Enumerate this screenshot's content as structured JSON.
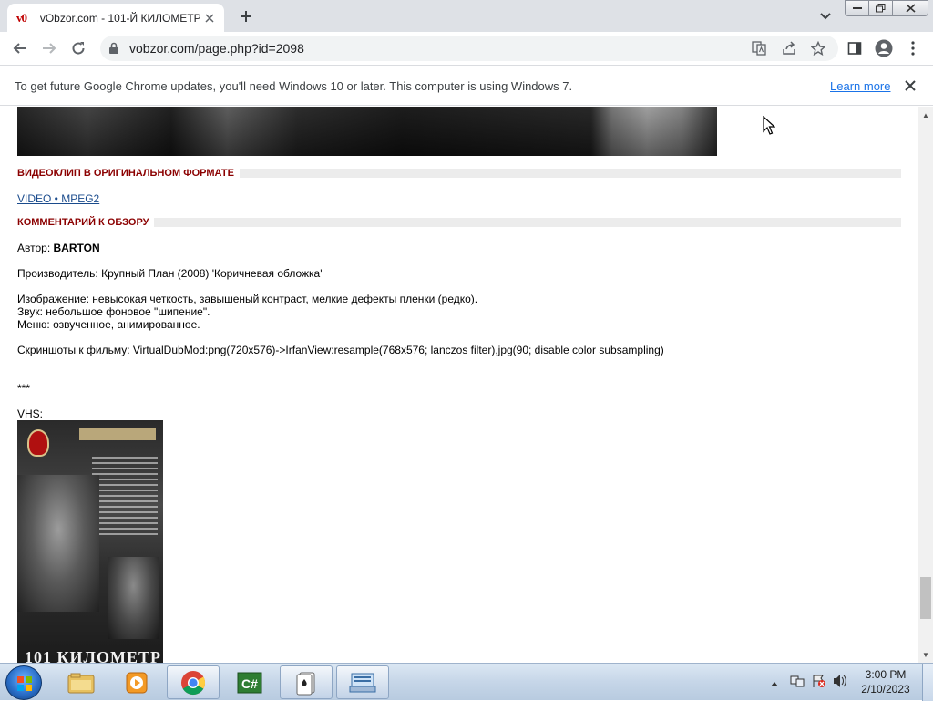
{
  "browser": {
    "tab": {
      "favicon_text": "v0",
      "title": "vObzor.com - 101-Й КИЛОМЕТР"
    },
    "address": {
      "url": "vobzor.com/page.php?id=2098"
    },
    "window_controls": [
      "minimize",
      "maximize",
      "close"
    ]
  },
  "infobar": {
    "message": "To get future Google Chrome updates, you'll need Windows 10 or later. This computer is using Windows 7.",
    "link": "Learn more"
  },
  "page": {
    "sections": {
      "video_clip_title": "ВИДЕОКЛИП В ОРИГИНАЛЬНОМ ФОРМАТЕ",
      "video_link": "VIDEO • MPEG2",
      "comment_title": "КОММЕНТАРИЙ К ОБЗОРУ"
    },
    "author_label": "Автор:",
    "author_name": "BARTON",
    "producer": "Производитель: Крупный План (2008) 'Коричневая обложка'",
    "image_quality": "Изображение: невысокая четкость, завышеный контраст, мелкие дефекты пленки (редко).",
    "sound": "Звук: небольшое фоновое \"шипение\".",
    "menu": "Меню: озвученное, анимированное.",
    "screenshots": "Скриншоты к фильму: VirtualDubMod:png(720x576)->IrfanView:resample(768x576; lanczos filter),jpg(90; disable color subsampling)",
    "separator": "***",
    "vhs_label": "VHS:",
    "poster_title": "101 КИЛОМЕТР"
  },
  "taskbar": {
    "pinned": [
      "windows-explorer",
      "media-player",
      "chrome",
      "csharp-editor",
      "solitaire",
      "keyboard-app"
    ],
    "clock": {
      "time": "3:00 PM",
      "date": "2/10/2023"
    }
  }
}
